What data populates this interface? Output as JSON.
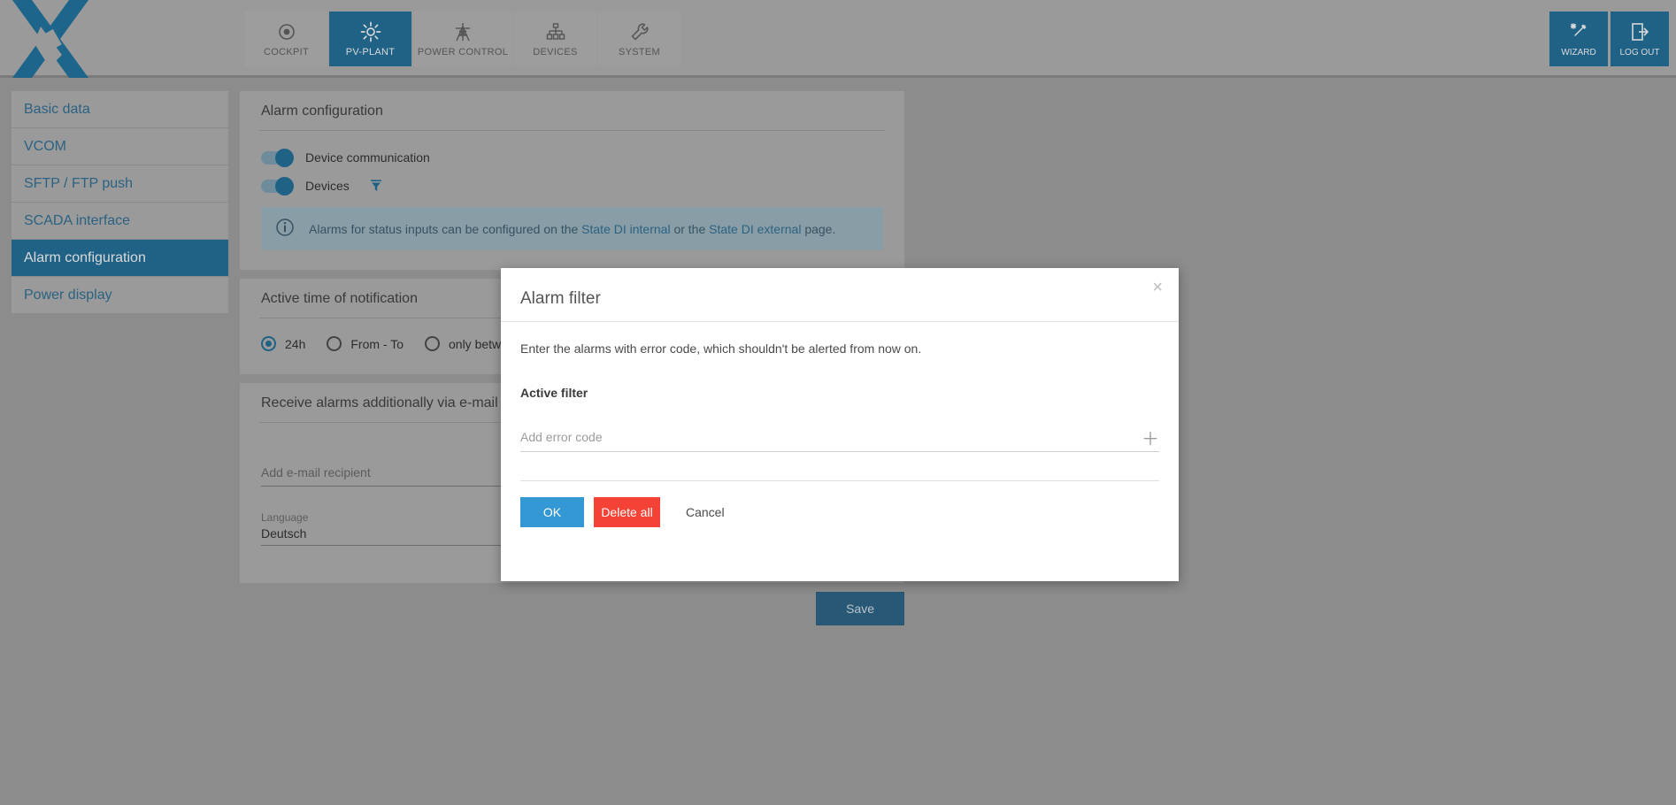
{
  "header": {
    "logo_name": "x-logo",
    "tabs": [
      {
        "label": "COCKPIT",
        "icon": "target-icon",
        "active": false
      },
      {
        "label": "PV-PLANT",
        "icon": "sun-icon",
        "active": true
      },
      {
        "label": "POWER CONTROL",
        "icon": "pylon-icon",
        "active": false
      },
      {
        "label": "DEVICES",
        "icon": "hierarchy-icon",
        "active": false
      },
      {
        "label": "SYSTEM",
        "icon": "wrench-icon",
        "active": false
      }
    ],
    "actions": [
      {
        "label": "WIZARD",
        "icon": "magic-wand-icon"
      },
      {
        "label": "LOG OUT",
        "icon": "logout-door-icon"
      }
    ]
  },
  "sidebar": {
    "items": [
      {
        "label": "Basic data",
        "active": false
      },
      {
        "label": "VCOM",
        "active": false
      },
      {
        "label": "SFTP / FTP push",
        "active": false
      },
      {
        "label": "SCADA interface",
        "active": false
      },
      {
        "label": "Alarm configuration",
        "active": true
      },
      {
        "label": "Power display",
        "active": false
      }
    ]
  },
  "alarm_config": {
    "title": "Alarm configuration",
    "toggles": [
      {
        "label": "Device communication",
        "on": true,
        "has_filter": false
      },
      {
        "label": "Devices",
        "on": true,
        "has_filter": true
      }
    ],
    "info": {
      "icon": "info-circle-icon",
      "text_before": "Alarms for status inputs can be configured on the ",
      "link1": "State DI internal",
      "text_middle": " or the ",
      "link2": "State DI external",
      "text_after": " page."
    }
  },
  "active_time": {
    "title": "Active time of notification",
    "options": [
      {
        "label": "24h",
        "selected": true
      },
      {
        "label": "From - To",
        "selected": false
      },
      {
        "label": "only betw",
        "selected": false
      }
    ]
  },
  "email_section": {
    "title": "Receive alarms additionally via e-mail",
    "recipient_placeholder": "Add e-mail recipient",
    "language_label": "Language",
    "language_value": "Deutsch"
  },
  "footer": {
    "save_label": "Save"
  },
  "modal": {
    "title": "Alarm filter",
    "close_glyph": "×",
    "description": "Enter the alarms with error code, which shouldn't be alerted from now on.",
    "subheading": "Active filter",
    "input_placeholder": "Add error code",
    "add_glyph": "＋",
    "buttons": {
      "ok": "OK",
      "delete_all": "Delete all",
      "cancel": "Cancel"
    }
  },
  "colors": {
    "brand_blue": "#1f6f9c",
    "accent_blue": "#3498d4",
    "danger_red": "#f44336",
    "page_bg": "#a3a3a3",
    "panel_bg": "#b4b4b4",
    "info_bg": "#9fb8c2",
    "save_blue": "#2a6389"
  }
}
